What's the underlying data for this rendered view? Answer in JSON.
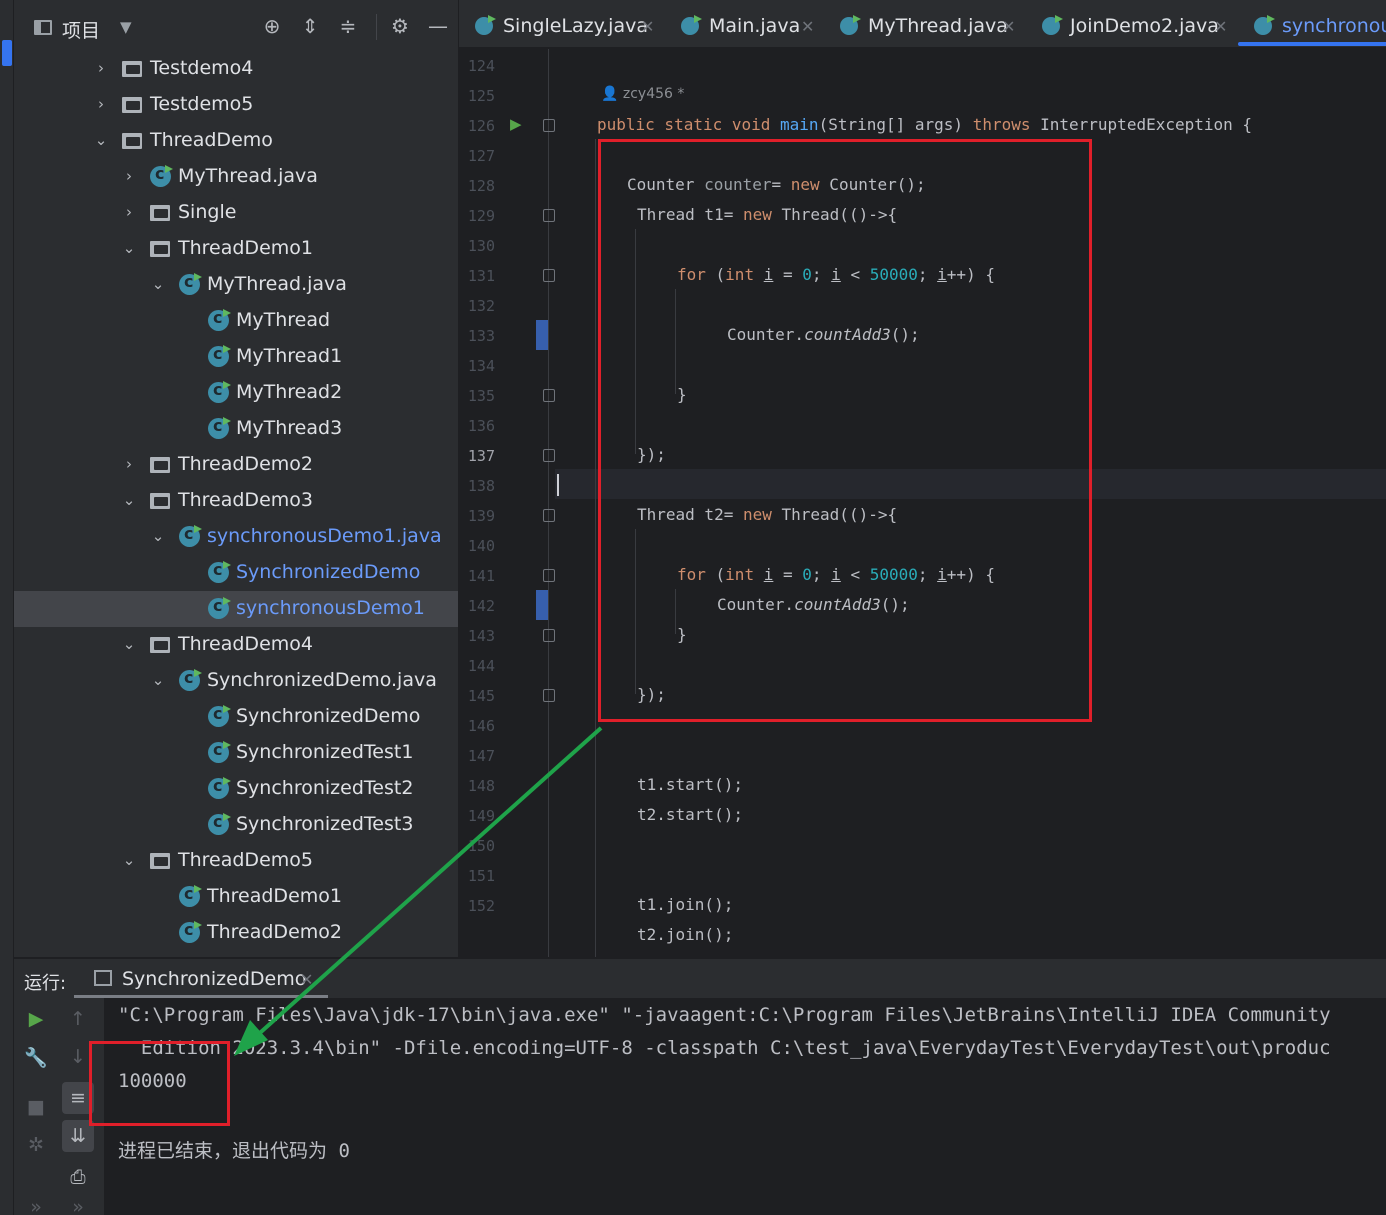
{
  "project_panel": {
    "title": "项目",
    "tree": [
      {
        "label": "Testdemo4",
        "type": "dir",
        "expanded": false,
        "depth": 0
      },
      {
        "label": "Testdemo5",
        "type": "dir",
        "expanded": false,
        "depth": 0
      },
      {
        "label": "ThreadDemo",
        "type": "dir",
        "expanded": true,
        "depth": 0
      },
      {
        "label": "MyThread.java",
        "type": "file",
        "expanded": false,
        "depth": 1
      },
      {
        "label": "Single",
        "type": "dir",
        "expanded": false,
        "depth": 1
      },
      {
        "label": "ThreadDemo1",
        "type": "dir",
        "expanded": true,
        "depth": 1
      },
      {
        "label": "MyThread.java",
        "type": "file",
        "expanded": true,
        "depth": 2
      },
      {
        "label": "MyThread",
        "type": "class",
        "depth": 3
      },
      {
        "label": "MyThread1",
        "type": "class",
        "depth": 3
      },
      {
        "label": "MyThread2",
        "type": "class",
        "depth": 3
      },
      {
        "label": "MyThread3",
        "type": "class",
        "depth": 3
      },
      {
        "label": "ThreadDemo2",
        "type": "dir",
        "expanded": false,
        "depth": 1
      },
      {
        "label": "ThreadDemo3",
        "type": "dir",
        "expanded": true,
        "depth": 1
      },
      {
        "label": "synchronousDemo1.java",
        "type": "file",
        "expanded": true,
        "depth": 2,
        "highlight": true
      },
      {
        "label": "SynchronizedDemo",
        "type": "class",
        "depth": 3,
        "highlight": true
      },
      {
        "label": "synchronousDemo1",
        "type": "class",
        "depth": 3,
        "highlight": true,
        "selected": true
      },
      {
        "label": "ThreadDemo4",
        "type": "dir",
        "expanded": true,
        "depth": 1
      },
      {
        "label": "SynchronizedDemo.java",
        "type": "file",
        "expanded": true,
        "depth": 2
      },
      {
        "label": "SynchronizedDemo",
        "type": "class",
        "depth": 3
      },
      {
        "label": "SynchronizedTest1",
        "type": "class",
        "depth": 3
      },
      {
        "label": "SynchronizedTest2",
        "type": "class",
        "depth": 3
      },
      {
        "label": "SynchronizedTest3",
        "type": "class",
        "depth": 3
      },
      {
        "label": "ThreadDemo5",
        "type": "dir",
        "expanded": true,
        "depth": 1
      },
      {
        "label": "ThreadDemo1",
        "type": "class",
        "depth": 2
      },
      {
        "label": "ThreadDemo2",
        "type": "class",
        "depth": 2
      }
    ]
  },
  "tabs": [
    {
      "label": "SingleLazy.java"
    },
    {
      "label": "Main.java"
    },
    {
      "label": "MyThread.java"
    },
    {
      "label": "JoinDemo2.java"
    },
    {
      "label": "synchronous",
      "active": true
    }
  ],
  "editor": {
    "author": "zcy456 *",
    "current_line": "137",
    "line_numbers": [
      "124",
      "125",
      "126",
      "127",
      "128",
      "129",
      "130",
      "131",
      "132",
      "133",
      "134",
      "135",
      "136",
      "137",
      "138",
      "139",
      "140",
      "141",
      "142",
      "143",
      "144",
      "145",
      "146",
      "147",
      "148",
      "149",
      "150",
      "151",
      "152"
    ],
    "code": {
      "l125": {
        "a": "public static void ",
        "b": "main",
        "c": "(String[] args) ",
        "d": "throws",
        "e": " InterruptedException {"
      },
      "l127": {
        "a": "Counter ",
        "b": "counter",
        "c": "= ",
        "d": "new",
        "e": " Counter();"
      },
      "l128": {
        "a": "Thread t1= ",
        "b": "new",
        "c": " Thread(()->{"
      },
      "l130": {
        "kw": "for",
        "p1": " (",
        "int": "int",
        "p2": " ",
        "i1": "i",
        "p3": " = ",
        "n0": "0",
        "p4": "; ",
        "i2": "i",
        "p5": " < ",
        "n1": "50000",
        "p6": "; ",
        "i3": "i",
        "p7": "++) {"
      },
      "l132": {
        "a": "Counter.",
        "b": "countAdd3",
        "c": "();"
      },
      "l134": "}",
      "l136": "});",
      "l138": {
        "a": "Thread t2= ",
        "b": "new",
        "c": " Thread(()->{"
      },
      "l140": {
        "kw": "for",
        "p1": " (",
        "int": "int",
        "p2": " ",
        "i1": "i",
        "p3": " = ",
        "n0": "0",
        "p4": "; ",
        "i2": "i",
        "p5": " < ",
        "n1": "50000",
        "p6": "; ",
        "i3": "i",
        "p7": "++) {"
      },
      "l141": {
        "a": "Counter.",
        "b": "countAdd3",
        "c": "();"
      },
      "l142": "}",
      "l144": "});",
      "l147": "t1.start();",
      "l148": "t2.start();",
      "l151": "t1.join();",
      "l152": "t2.join();"
    }
  },
  "run_panel": {
    "label": "运行:",
    "tab": "SynchronizedDemo",
    "console": [
      "\"C:\\Program Files\\Java\\jdk-17\\bin\\java.exe\" \"-javaagent:C:\\Program Files\\JetBrains\\IntelliJ IDEA Community",
      "  Edition 2023.3.4\\bin\" -Dfile.encoding=UTF-8 -classpath C:\\test_java\\EverydayTest\\EverydayTest\\out\\produc",
      "100000",
      "进程已结束，退出代码为 0"
    ]
  },
  "colors": {
    "accent": "#3574f0",
    "annotation_red": "#e01f2a",
    "annotation_green": "#1fa34a"
  }
}
